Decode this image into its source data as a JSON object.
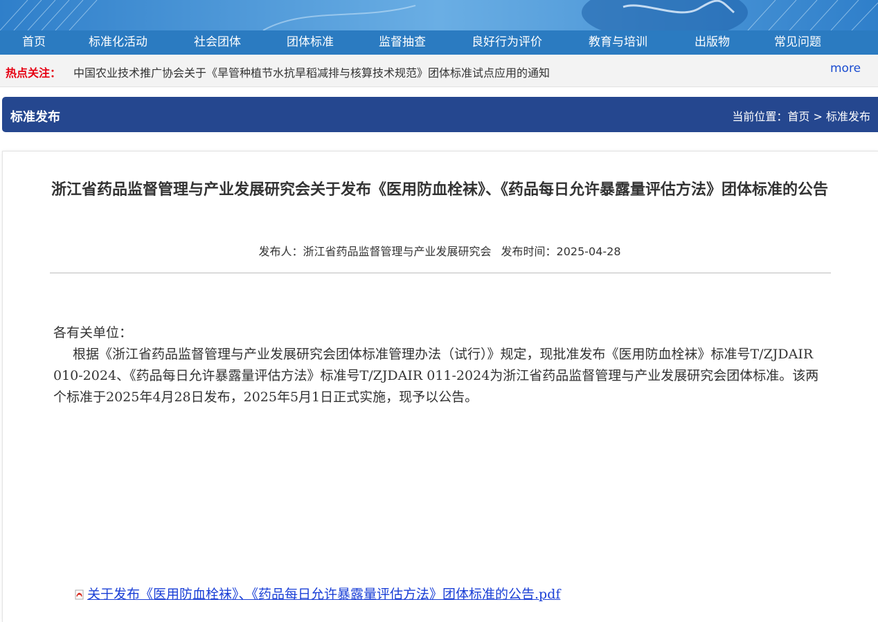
{
  "nav": {
    "items": [
      {
        "label": "首页"
      },
      {
        "label": "标准化活动"
      },
      {
        "label": "社会团体"
      },
      {
        "label": "团体标准"
      },
      {
        "label": "监督抽查"
      },
      {
        "label": "良好行为评价"
      },
      {
        "label": "教育与培训"
      },
      {
        "label": "出版物"
      },
      {
        "label": "常见问题"
      }
    ]
  },
  "hot": {
    "label": "热点关注：",
    "text": "中国农业技术推广协会关于《旱管种植节水抗旱稻减排与核算技术规范》团体标准试点应用的通知",
    "more": "more"
  },
  "section": {
    "title": "标准发布",
    "breadcrumb_prefix": "当前位置：",
    "breadcrumb_home": "首页",
    "breadcrumb_sep": " > ",
    "breadcrumb_current": "标准发布"
  },
  "article": {
    "title": "浙江省药品监督管理与产业发展研究会关于发布《医用防血栓袜》、《药品每日允许暴露量评估方法》团体标准的公告",
    "publisher_label": "发布人：",
    "publisher": "浙江省药品监督管理与产业发展研究会",
    "date_label": "发布时间：",
    "date": "2025-04-28",
    "salutation": "各有关单位：",
    "body": "根据《浙江省药品监督管理与产业发展研究会团体标准管理办法（试行）》规定，现批准发布《医用防血栓袜》标准号T/ZJDAIR 010-2024、《药品每日允许暴露量评估方法》标准号T/ZJDAIR 011-2024为浙江省药品监督管理与产业发展研究会团体标准。该两个标准于2025年4月28日发布，2025年5月1日正式实施，现予以公告。",
    "attachment": "关于发布《医用防血栓袜》、《药品每日允许暴露量评估方法》团体标准的公告.pdf"
  },
  "colors": {
    "nav_bg": "#2b7bc1",
    "section_bg": "#25478f",
    "hot_label": "#e60012",
    "link": "#1a3fd6"
  },
  "icons": {
    "attachment_icon": "pdf-icon"
  }
}
